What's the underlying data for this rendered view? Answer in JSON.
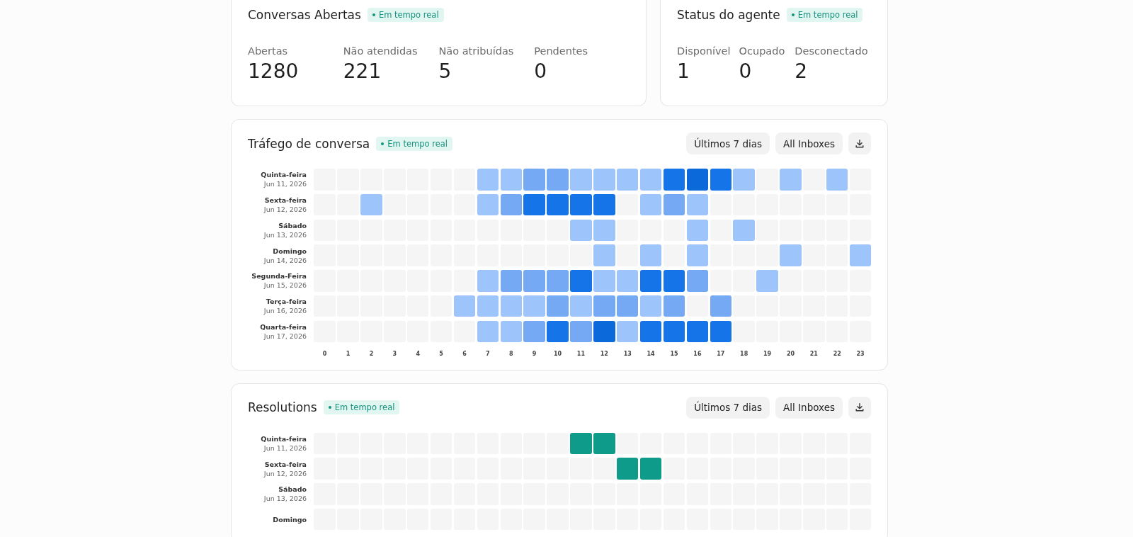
{
  "open_conversations": {
    "title": "Conversas Abertas",
    "badge": "Em tempo real",
    "metrics": [
      {
        "label": "Abertas",
        "value": "1280"
      },
      {
        "label": "Não atendidas",
        "value": "221"
      },
      {
        "label": "Não atribuídas",
        "value": "5"
      },
      {
        "label": "Pendentes",
        "value": "0"
      }
    ]
  },
  "agent_status": {
    "title": "Status do agente",
    "badge": "Em tempo real",
    "metrics": [
      {
        "label": "Disponível",
        "value": "1"
      },
      {
        "label": "Ocupado",
        "value": "0"
      },
      {
        "label": "Desconectado",
        "value": "2"
      }
    ]
  },
  "heatmaps": [
    {
      "title": "Tráfego de conversa",
      "badge": "Em tempo real",
      "range_button": "Últimos 7 dias",
      "inbox_button": "All Inboxes",
      "hours": [
        "0",
        "1",
        "2",
        "3",
        "4",
        "5",
        "6",
        "7",
        "8",
        "9",
        "10",
        "11",
        "12",
        "13",
        "14",
        "15",
        "16",
        "17",
        "18",
        "19",
        "20",
        "21",
        "22",
        "23"
      ],
      "rows": [
        {
          "day": "Quinta-feira",
          "date": "Jun 11, 2026",
          "cells": [
            {
              "color": "#f5f5f6"
            },
            {
              "color": "#f5f5f6"
            },
            {
              "color": "#f5f5f6"
            },
            {
              "color": "#f5f5f6"
            },
            {
              "color": "#f5f5f6"
            },
            {
              "color": "#f5f5f6"
            },
            {
              "color": "#f5f5f6"
            },
            {
              "color": "#9dc4fb"
            },
            {
              "color": "#9dc4fb"
            },
            {
              "color": "#76a9f4"
            },
            {
              "color": "#76a9f4"
            },
            {
              "color": "#9dc4fb"
            },
            {
              "color": "#9dc4fb"
            },
            {
              "color": "#9dc4fb"
            },
            {
              "color": "#9dc4fb"
            },
            {
              "color": "#1575e8"
            },
            {
              "color": "#0b69d9"
            },
            {
              "color": "#1575e8"
            },
            {
              "color": "#9dc4fb"
            },
            {
              "color": "#f5f5f6"
            },
            {
              "color": "#9dc4fb"
            },
            {
              "color": "#f5f5f6"
            },
            {
              "color": "#9dc4fb"
            },
            {
              "color": "#f5f5f6"
            }
          ]
        },
        {
          "day": "Sexta-feira",
          "date": "Jun 12, 2026",
          "cells": [
            {
              "color": "#f5f5f6"
            },
            {
              "color": "#f5f5f6"
            },
            {
              "color": "#9dc4fb"
            },
            {
              "color": "#f5f5f6"
            },
            {
              "color": "#f5f5f6"
            },
            {
              "color": "#f5f5f6"
            },
            {
              "color": "#f5f5f6"
            },
            {
              "color": "#9dc4fb"
            },
            {
              "color": "#76a9f4"
            },
            {
              "color": "#1575e8"
            },
            {
              "color": "#1575e8"
            },
            {
              "color": "#1575e8"
            },
            {
              "color": "#1575e8"
            },
            {
              "color": "#f5f5f6"
            },
            {
              "color": "#9dc4fb"
            },
            {
              "color": "#76a9f4"
            },
            {
              "color": "#9dc4fb"
            },
            {
              "color": "#f5f5f6"
            },
            {
              "color": "#f5f5f6"
            },
            {
              "color": "#f5f5f6"
            },
            {
              "color": "#f5f5f6"
            },
            {
              "color": "#f5f5f6"
            },
            {
              "color": "#f5f5f6"
            },
            {
              "color": "#f5f5f6"
            }
          ]
        },
        {
          "day": "Sábado",
          "date": "Jun 13, 2026",
          "cells": [
            {
              "color": "#f5f5f6"
            },
            {
              "color": "#f5f5f6"
            },
            {
              "color": "#f5f5f6"
            },
            {
              "color": "#f5f5f6"
            },
            {
              "color": "#f5f5f6"
            },
            {
              "color": "#f5f5f6"
            },
            {
              "color": "#f5f5f6"
            },
            {
              "color": "#f5f5f6"
            },
            {
              "color": "#f5f5f6"
            },
            {
              "color": "#f5f5f6"
            },
            {
              "color": "#f5f5f6"
            },
            {
              "color": "#9dc4fb"
            },
            {
              "color": "#9dc4fb"
            },
            {
              "color": "#f5f5f6"
            },
            {
              "color": "#f5f5f6"
            },
            {
              "color": "#f5f5f6"
            },
            {
              "color": "#9dc4fb"
            },
            {
              "color": "#f5f5f6"
            },
            {
              "color": "#9dc4fb"
            },
            {
              "color": "#f5f5f6"
            },
            {
              "color": "#f5f5f6"
            },
            {
              "color": "#f5f5f6"
            },
            {
              "color": "#f5f5f6"
            },
            {
              "color": "#f5f5f6"
            }
          ]
        },
        {
          "day": "Domingo",
          "date": "Jun 14, 2026",
          "cells": [
            {
              "color": "#f5f5f6"
            },
            {
              "color": "#f5f5f6"
            },
            {
              "color": "#f5f5f6"
            },
            {
              "color": "#f5f5f6"
            },
            {
              "color": "#f5f5f6"
            },
            {
              "color": "#f5f5f6"
            },
            {
              "color": "#f5f5f6"
            },
            {
              "color": "#f5f5f6"
            },
            {
              "color": "#f5f5f6"
            },
            {
              "color": "#f5f5f6"
            },
            {
              "color": "#f5f5f6"
            },
            {
              "color": "#f5f5f6"
            },
            {
              "color": "#9dc4fb"
            },
            {
              "color": "#f5f5f6"
            },
            {
              "color": "#9dc4fb"
            },
            {
              "color": "#f5f5f6"
            },
            {
              "color": "#9dc4fb"
            },
            {
              "color": "#f5f5f6"
            },
            {
              "color": "#f5f5f6"
            },
            {
              "color": "#f5f5f6"
            },
            {
              "color": "#9dc4fb"
            },
            {
              "color": "#f5f5f6"
            },
            {
              "color": "#f5f5f6"
            },
            {
              "color": "#9dc4fb"
            }
          ]
        },
        {
          "day": "Segunda-Feira",
          "date": "Jun 15, 2026",
          "cells": [
            {
              "color": "#f5f5f6"
            },
            {
              "color": "#f5f5f6"
            },
            {
              "color": "#f5f5f6"
            },
            {
              "color": "#f5f5f6"
            },
            {
              "color": "#f5f5f6"
            },
            {
              "color": "#f5f5f6"
            },
            {
              "color": "#f5f5f6"
            },
            {
              "color": "#9dc4fb"
            },
            {
              "color": "#76a9f4"
            },
            {
              "color": "#76a9f4"
            },
            {
              "color": "#76a9f4"
            },
            {
              "color": "#1575e8"
            },
            {
              "color": "#9dc4fb"
            },
            {
              "color": "#9dc4fb"
            },
            {
              "color": "#1575e8"
            },
            {
              "color": "#1575e8"
            },
            {
              "color": "#76a9f4"
            },
            {
              "color": "#f5f5f6"
            },
            {
              "color": "#f5f5f6"
            },
            {
              "color": "#9dc4fb"
            },
            {
              "color": "#f5f5f6"
            },
            {
              "color": "#f5f5f6"
            },
            {
              "color": "#f5f5f6"
            },
            {
              "color": "#f5f5f6"
            }
          ]
        },
        {
          "day": "Terça-feira",
          "date": "Jun 16, 2026",
          "cells": [
            {
              "color": "#f5f5f6"
            },
            {
              "color": "#f5f5f6"
            },
            {
              "color": "#f5f5f6"
            },
            {
              "color": "#f5f5f6"
            },
            {
              "color": "#f5f5f6"
            },
            {
              "color": "#f5f5f6"
            },
            {
              "color": "#9dc4fb"
            },
            {
              "color": "#9dc4fb"
            },
            {
              "color": "#9dc4fb"
            },
            {
              "color": "#9dc4fb"
            },
            {
              "color": "#76a9f4"
            },
            {
              "color": "#9dc4fb"
            },
            {
              "color": "#76a9f4"
            },
            {
              "color": "#76a9f4"
            },
            {
              "color": "#9dc4fb"
            },
            {
              "color": "#76a9f4"
            },
            {
              "color": "#f5f5f6"
            },
            {
              "color": "#76a9f4"
            },
            {
              "color": "#f5f5f6"
            },
            {
              "color": "#f5f5f6"
            },
            {
              "color": "#f5f5f6"
            },
            {
              "color": "#f5f5f6"
            },
            {
              "color": "#f5f5f6"
            },
            {
              "color": "#f5f5f6"
            }
          ]
        },
        {
          "day": "Quarta-feira",
          "date": "Jun 17, 2026",
          "cells": [
            {
              "color": "#f5f5f6"
            },
            {
              "color": "#f5f5f6"
            },
            {
              "color": "#f5f5f6"
            },
            {
              "color": "#f5f5f6"
            },
            {
              "color": "#f5f5f6"
            },
            {
              "color": "#f5f5f6"
            },
            {
              "color": "#f5f5f6"
            },
            {
              "color": "#9dc4fb"
            },
            {
              "color": "#9dc4fb"
            },
            {
              "color": "#76a9f4"
            },
            {
              "color": "#1575e8"
            },
            {
              "color": "#76a9f4"
            },
            {
              "color": "#0b69d9"
            },
            {
              "color": "#9dc4fb"
            },
            {
              "color": "#1575e8"
            },
            {
              "color": "#1575e8"
            },
            {
              "color": "#1575e8"
            },
            {
              "color": "#1575e8"
            },
            {
              "color": "#f5f5f6"
            },
            {
              "color": "#f5f5f6"
            },
            {
              "color": "#f5f5f6"
            },
            {
              "color": "#f5f5f6"
            },
            {
              "color": "#f5f5f6"
            },
            {
              "color": "#f5f5f6"
            }
          ]
        }
      ]
    },
    {
      "title": "Resolutions",
      "badge": "Em tempo real",
      "range_button": "Últimos 7 dias",
      "inbox_button": "All Inboxes",
      "rows": [
        {
          "day": "Quinta-feira",
          "date": "Jun 11, 2026",
          "cells": [
            {
              "color": "#f5f5f6"
            },
            {
              "color": "#f5f5f6"
            },
            {
              "color": "#f5f5f6"
            },
            {
              "color": "#f5f5f6"
            },
            {
              "color": "#f5f5f6"
            },
            {
              "color": "#f5f5f6"
            },
            {
              "color": "#f5f5f6"
            },
            {
              "color": "#f5f5f6"
            },
            {
              "color": "#f5f5f6"
            },
            {
              "color": "#f5f5f6"
            },
            {
              "color": "#f5f5f6"
            },
            {
              "color": "#0f9b8a"
            },
            {
              "color": "#0f9b8a"
            },
            {
              "color": "#f5f5f6"
            },
            {
              "color": "#f5f5f6"
            },
            {
              "color": "#f5f5f6"
            },
            {
              "color": "#f5f5f6"
            },
            {
              "color": "#f5f5f6"
            },
            {
              "color": "#f5f5f6"
            },
            {
              "color": "#f5f5f6"
            },
            {
              "color": "#f5f5f6"
            },
            {
              "color": "#f5f5f6"
            },
            {
              "color": "#f5f5f6"
            },
            {
              "color": "#f5f5f6"
            }
          ]
        },
        {
          "day": "Sexta-feira",
          "date": "Jun 12, 2026",
          "cells": [
            {
              "color": "#f5f5f6"
            },
            {
              "color": "#f5f5f6"
            },
            {
              "color": "#f5f5f6"
            },
            {
              "color": "#f5f5f6"
            },
            {
              "color": "#f5f5f6"
            },
            {
              "color": "#f5f5f6"
            },
            {
              "color": "#f5f5f6"
            },
            {
              "color": "#f5f5f6"
            },
            {
              "color": "#f5f5f6"
            },
            {
              "color": "#f5f5f6"
            },
            {
              "color": "#f5f5f6"
            },
            {
              "color": "#f5f5f6"
            },
            {
              "color": "#f5f5f6"
            },
            {
              "color": "#0f9b8a"
            },
            {
              "color": "#0f9b8a"
            },
            {
              "color": "#f5f5f6"
            },
            {
              "color": "#f5f5f6"
            },
            {
              "color": "#f5f5f6"
            },
            {
              "color": "#f5f5f6"
            },
            {
              "color": "#f5f5f6"
            },
            {
              "color": "#f5f5f6"
            },
            {
              "color": "#f5f5f6"
            },
            {
              "color": "#f5f5f6"
            },
            {
              "color": "#f5f5f6"
            }
          ]
        },
        {
          "day": "Sábado",
          "date": "Jun 13, 2026",
          "cells": [
            {
              "color": "#f5f5f6"
            },
            {
              "color": "#f5f5f6"
            },
            {
              "color": "#f5f5f6"
            },
            {
              "color": "#f5f5f6"
            },
            {
              "color": "#f5f5f6"
            },
            {
              "color": "#f5f5f6"
            },
            {
              "color": "#f5f5f6"
            },
            {
              "color": "#f5f5f6"
            },
            {
              "color": "#f5f5f6"
            },
            {
              "color": "#f5f5f6"
            },
            {
              "color": "#f5f5f6"
            },
            {
              "color": "#f5f5f6"
            },
            {
              "color": "#f5f5f6"
            },
            {
              "color": "#f5f5f6"
            },
            {
              "color": "#f5f5f6"
            },
            {
              "color": "#f5f5f6"
            },
            {
              "color": "#f5f5f6"
            },
            {
              "color": "#f5f5f6"
            },
            {
              "color": "#f5f5f6"
            },
            {
              "color": "#f5f5f6"
            },
            {
              "color": "#f5f5f6"
            },
            {
              "color": "#f5f5f6"
            },
            {
              "color": "#f5f5f6"
            },
            {
              "color": "#f5f5f6"
            }
          ]
        },
        {
          "day": "Domingo",
          "cells": [
            {
              "color": "#f5f5f6"
            },
            {
              "color": "#f5f5f6"
            },
            {
              "color": "#f5f5f6"
            },
            {
              "color": "#f5f5f6"
            },
            {
              "color": "#f5f5f6"
            },
            {
              "color": "#f5f5f6"
            },
            {
              "color": "#f5f5f6"
            },
            {
              "color": "#f5f5f6"
            },
            {
              "color": "#f5f5f6"
            },
            {
              "color": "#f5f5f6"
            },
            {
              "color": "#f5f5f6"
            },
            {
              "color": "#f5f5f6"
            },
            {
              "color": "#f5f5f6"
            },
            {
              "color": "#f5f5f6"
            },
            {
              "color": "#f5f5f6"
            },
            {
              "color": "#f5f5f6"
            },
            {
              "color": "#f5f5f6"
            },
            {
              "color": "#f5f5f6"
            },
            {
              "color": "#f5f5f6"
            },
            {
              "color": "#f5f5f6"
            },
            {
              "color": "#f5f5f6"
            },
            {
              "color": "#f5f5f6"
            },
            {
              "color": "#f5f5f6"
            },
            {
              "color": "#f5f5f6"
            }
          ]
        }
      ]
    }
  ]
}
